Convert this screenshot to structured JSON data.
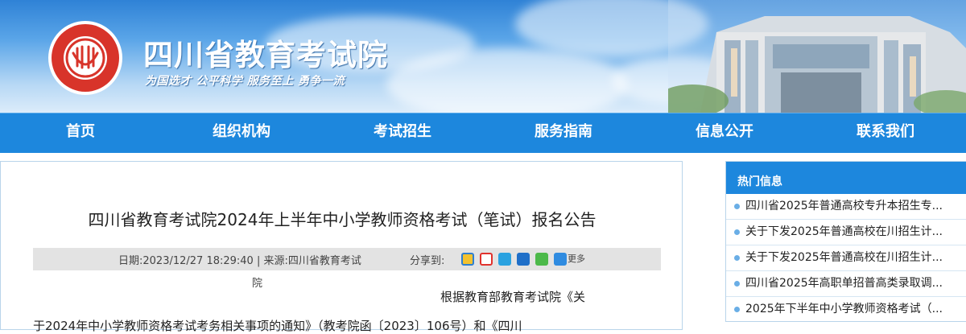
{
  "header": {
    "site_title": "四川省教育考试院",
    "motto": "为国选才  公平科学  服务至上  勇争一流",
    "logo_icon": "sichuan-education-exam-seal-icon",
    "colors": {
      "sky_top": "#2f82d6",
      "nav": "#1d87dd"
    }
  },
  "nav": {
    "items": [
      {
        "label": "首页"
      },
      {
        "label": "组织机构"
      },
      {
        "label": "考试招生"
      },
      {
        "label": "服务指南"
      },
      {
        "label": "信息公开"
      },
      {
        "label": "联系我们"
      }
    ]
  },
  "article": {
    "title": "四川省教育考试院2024年上半年中小学教师资格考试（笔试）报名公告",
    "meta": "日期:2023/12/27 18:29:40 | 来源:四川省教育考试",
    "meta_wrap": "院",
    "share_label": "分享到:",
    "share_icons": [
      "qzone-icon",
      "weibo-icon",
      "tencent-weibo-icon",
      "renren-icon",
      "wechat-icon",
      "more-share-icon"
    ],
    "share_more": "更多",
    "body_line1": "根据教育部教育考试院《关",
    "body_line2": "于2024年中小学教师资格考试考务相关事项的通知》（教考院函〔2023〕106号）和《四川"
  },
  "hot_info": {
    "header": "热门信息",
    "items": [
      {
        "label": "四川省2025年普通高校专升本招生专..."
      },
      {
        "label": "关于下发2025年普通高校在川招生计..."
      },
      {
        "label": "关于下发2025年普通高校在川招生计..."
      },
      {
        "label": "四川省2025年高职单招普高类录取调..."
      },
      {
        "label": "2025年下半年中小学教师资格考试（..."
      }
    ]
  }
}
